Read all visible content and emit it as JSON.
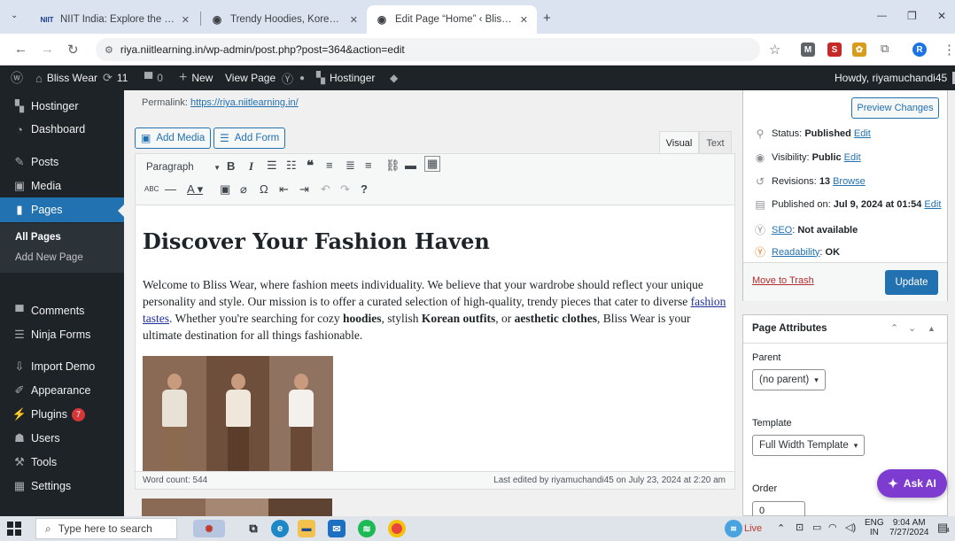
{
  "browser": {
    "tabs": [
      {
        "title": "NIIT India: Explore the Best Onli",
        "favicon": "NIIT"
      },
      {
        "title": "Trendy Hoodies, Korean Outfits",
        "favicon": "globe-icon"
      },
      {
        "title": "Edit Page “Home” ‹ Bliss Wear —",
        "favicon": "globe-icon"
      }
    ],
    "new_tab": "+",
    "url": "riya.niitlearning.in/wp-admin/post.php?post=364&action=edit",
    "win_min": "—",
    "win_max": "❐",
    "win_close": "✕"
  },
  "adminbar": {
    "site_name": "Bliss Wear",
    "updates_count": "11",
    "comments_count": "0",
    "new_label": "New",
    "view_page": "View Page",
    "hostinger": "Hostinger",
    "howdy": "Howdy, riyamuchandi45"
  },
  "sidebar": {
    "items": [
      {
        "label": "Hostinger",
        "icon": "hostinger-icon"
      },
      {
        "label": "Dashboard",
        "icon": "dashboard-icon"
      },
      {
        "label": "Posts",
        "icon": "pin-icon"
      },
      {
        "label": "Media",
        "icon": "media-icon"
      },
      {
        "label": "Pages",
        "icon": "pages-icon"
      },
      {
        "label": "Comments",
        "icon": "comment-icon"
      },
      {
        "label": "Ninja Forms",
        "icon": "form-icon"
      },
      {
        "label": "Import Demo",
        "icon": "import-icon"
      },
      {
        "label": "Appearance",
        "icon": "brush-icon"
      },
      {
        "label": "Plugins",
        "icon": "plugin-icon"
      },
      {
        "label": "Users",
        "icon": "user-icon"
      },
      {
        "label": "Tools",
        "icon": "wrench-icon"
      },
      {
        "label": "Settings",
        "icon": "settings-icon"
      }
    ],
    "plugins_badge": "7",
    "submenu": {
      "all_pages": "All Pages",
      "add_new": "Add New Page"
    }
  },
  "editor": {
    "permalink_label": "Permalink:",
    "permalink_url": "https://riya.niitlearning.in/",
    "add_media": "Add Media",
    "add_form": "Add Form",
    "tab_visual": "Visual",
    "tab_text": "Text",
    "format": "Paragraph",
    "heading": "Discover Your Fashion Haven",
    "para_1": "Welcome to Bliss Wear, where fashion meets individuality. We believe that your wardrobe should reflect your unique personality and style. Our mission is to offer a curated selection of high-quality, trendy pieces that cater to diverse ",
    "para_link": "fashion tastes",
    "para_2": ". Whether you're searching for cozy ",
    "para_bold_1": "hoodies",
    "para_3": ", stylish ",
    "para_bold_2": "Korean outfits",
    "para_4": ", or ",
    "para_bold_3": "aesthetic clothes",
    "para_5": ", Bliss Wear is your ultimate destination for all things fashionable.",
    "word_count": "Word count: 544",
    "last_edited": "Last edited by riyamuchandi45 on July 23, 2024 at 2:20 am"
  },
  "publish": {
    "preview": "Preview Changes",
    "status_label": "Status:",
    "status_value": "Published",
    "status_edit": "Edit",
    "visibility_label": "Visibility:",
    "visibility_value": "Public",
    "visibility_edit": "Edit",
    "revisions_label": "Revisions:",
    "revisions_value": "13",
    "revisions_browse": "Browse",
    "published_label": "Published on:",
    "published_value": "Jul 9, 2024 at 01:54",
    "published_edit": "Edit",
    "seo_link": "SEO",
    "seo_value": "Not available",
    "readability_link": "Readability",
    "readability_value": "OK",
    "trash": "Move to Trash",
    "update": "Update"
  },
  "attributes": {
    "title": "Page Attributes",
    "parent_label": "Parent",
    "parent_value": "(no parent)",
    "template_label": "Template",
    "template_value": "Full Width Template",
    "order_label": "Order",
    "order_value": "0"
  },
  "ask_ai": "Ask AI",
  "taskbar": {
    "search_placeholder": "Type here to search",
    "live": "Live",
    "lang": "ENG",
    "region": "IN",
    "time": "9:04 AM",
    "date": "7/27/2024",
    "notif_count": "4"
  }
}
